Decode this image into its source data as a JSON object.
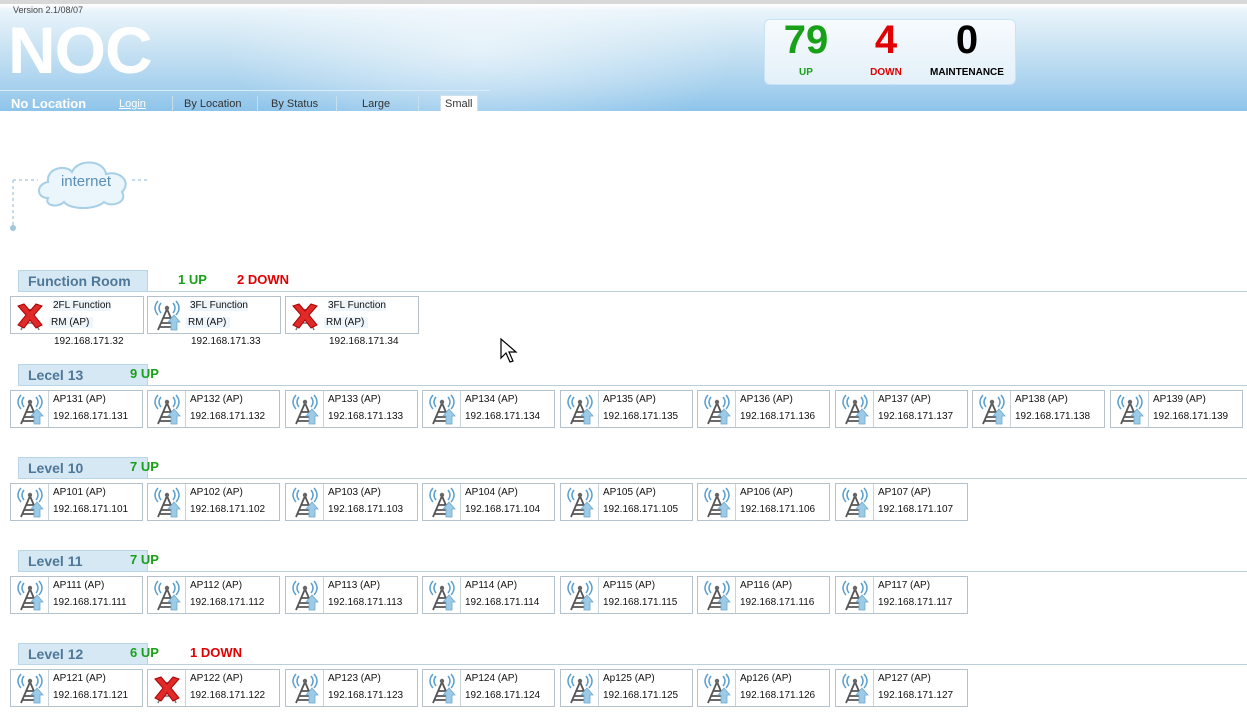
{
  "header": {
    "version": "Version 2.1/08/07",
    "title": "NOC",
    "location": "No Location",
    "nav": {
      "login": "Login",
      "by_location": "By Location",
      "by_status": "By Status",
      "large": "Large",
      "small": "Small"
    },
    "stats": {
      "up": {
        "value": "79",
        "label": "UP",
        "color": "#18a018"
      },
      "down": {
        "value": "4",
        "label": "DOWN",
        "color": "#e00000"
      },
      "maintenance": {
        "value": "0",
        "label": "MAINTENANCE",
        "color": "#000000"
      }
    }
  },
  "internet": {
    "label": "internet"
  },
  "groups": [
    {
      "name": "Function Room",
      "up": "1 UP",
      "down": "2 DOWN",
      "devices": [
        {
          "name": "2FL Function",
          "name2": "RM (AP)",
          "ip": "192.168.171.32",
          "status": "down"
        },
        {
          "name": "3FL Function",
          "name2": "RM (AP)",
          "ip": "192.168.171.33",
          "status": "up"
        },
        {
          "name": "3FL Function",
          "name2": "RM (AP)",
          "ip": "192.168.171.34",
          "status": "down"
        }
      ]
    },
    {
      "name": "Lecel 13",
      "up": "9 UP",
      "down": "",
      "devices": [
        {
          "name": "AP131 (AP)",
          "ip": "192.168.171.131",
          "status": "up"
        },
        {
          "name": "AP132 (AP)",
          "ip": "192.168.171.132",
          "status": "up"
        },
        {
          "name": "AP133 (AP)",
          "ip": "192.168.171.133",
          "status": "up"
        },
        {
          "name": "AP134 (AP)",
          "ip": "192.168.171.134",
          "status": "up"
        },
        {
          "name": "AP135 (AP)",
          "ip": "192.168.171.135",
          "status": "up"
        },
        {
          "name": "AP136 (AP)",
          "ip": "192.168.171.136",
          "status": "up"
        },
        {
          "name": "AP137 (AP)",
          "ip": "192.168.171.137",
          "status": "up"
        },
        {
          "name": "AP138 (AP)",
          "ip": "192.168.171.138",
          "status": "up"
        },
        {
          "name": "AP139 (AP)",
          "ip": "192.168.171.139",
          "status": "up"
        }
      ]
    },
    {
      "name": "Level 10",
      "up": "7 UP",
      "down": "",
      "devices": [
        {
          "name": "AP101 (AP)",
          "ip": "192.168.171.101",
          "status": "up"
        },
        {
          "name": "AP102 (AP)",
          "ip": "192.168.171.102",
          "status": "up"
        },
        {
          "name": "AP103 (AP)",
          "ip": "192.168.171.103",
          "status": "up"
        },
        {
          "name": "AP104 (AP)",
          "ip": "192.168.171.104",
          "status": "up"
        },
        {
          "name": "AP105 (AP)",
          "ip": "192.168.171.105",
          "status": "up"
        },
        {
          "name": "AP106 (AP)",
          "ip": "192.168.171.106",
          "status": "up"
        },
        {
          "name": "AP107 (AP)",
          "ip": "192.168.171.107",
          "status": "up"
        }
      ]
    },
    {
      "name": "Level 11",
      "up": "7 UP",
      "down": "",
      "devices": [
        {
          "name": "AP111 (AP)",
          "ip": "192.168.171.111",
          "status": "up"
        },
        {
          "name": "AP112 (AP)",
          "ip": "192.168.171.112",
          "status": "up"
        },
        {
          "name": "AP113 (AP)",
          "ip": "192.168.171.113",
          "status": "up"
        },
        {
          "name": "AP114 (AP)",
          "ip": "192.168.171.114",
          "status": "up"
        },
        {
          "name": "AP115 (AP)",
          "ip": "192.168.171.115",
          "status": "up"
        },
        {
          "name": "AP116 (AP)",
          "ip": "192.168.171.116",
          "status": "up"
        },
        {
          "name": "AP117 (AP)",
          "ip": "192.168.171.117",
          "status": "up"
        }
      ]
    },
    {
      "name": "Level 12",
      "up": "6 UP",
      "down": "1 DOWN",
      "devices": [
        {
          "name": "AP121 (AP)",
          "ip": "192.168.171.121",
          "status": "up"
        },
        {
          "name": "AP122 (AP)",
          "ip": "192.168.171.122",
          "status": "down"
        },
        {
          "name": "AP123 (AP)",
          "ip": "192.168.171.123",
          "status": "up"
        },
        {
          "name": "AP124 (AP)",
          "ip": "192.168.171.124",
          "status": "up"
        },
        {
          "name": "Ap125 (AP)",
          "ip": "192.168.171.125",
          "status": "up"
        },
        {
          "name": "Ap126 (AP)",
          "ip": "192.168.171.126",
          "status": "up"
        },
        {
          "name": "AP127 (AP)",
          "ip": "192.168.171.127",
          "status": "up"
        }
      ]
    }
  ]
}
